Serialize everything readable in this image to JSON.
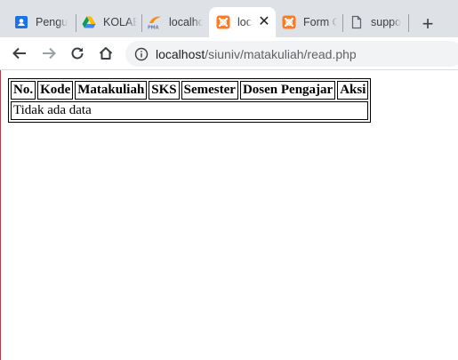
{
  "browser": {
    "tabs": [
      {
        "title": "Pengu",
        "icon": "contacts-icon"
      },
      {
        "title": "KOLAB",
        "icon": "google-drive-icon"
      },
      {
        "title": "localho",
        "icon": "phpmyadmin-icon"
      },
      {
        "title": "loc",
        "icon": "xampp-icon",
        "active": true
      },
      {
        "title": "Form C",
        "icon": "xampp-icon"
      },
      {
        "title": "suppo",
        "icon": "page-icon"
      }
    ],
    "new_tab_label": "+",
    "close_label": "✕",
    "url_host": "localhost",
    "url_path": "/siuniv/matakuliah/read.php"
  },
  "table": {
    "headers": [
      "No.",
      "Kode",
      "Matakuliah",
      "SKS",
      "Semester",
      "Dosen Pengajar",
      "Aksi"
    ],
    "empty_message": "Tidak ada data"
  },
  "colors": {
    "tabstrip": "#dee1e6",
    "omnibox": "#f1f3f4",
    "window_edge": "#b23a4a",
    "xampp_orange": "#fb7a24"
  }
}
